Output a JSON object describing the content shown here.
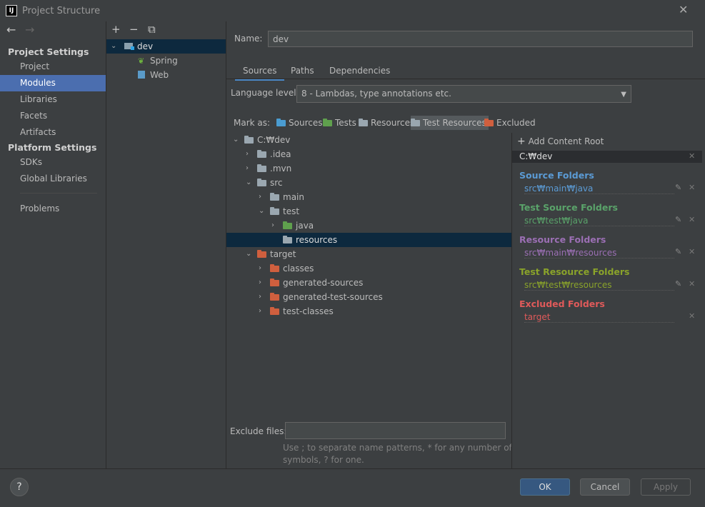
{
  "window": {
    "title": "Project Structure",
    "close": "✕"
  },
  "nav": {
    "back": "←",
    "forward": "→",
    "sections": [
      {
        "title": "Project Settings",
        "items": [
          "Project",
          "Modules",
          "Libraries",
          "Facets",
          "Artifacts"
        ]
      },
      {
        "title": "Platform Settings",
        "items": [
          "SDKs",
          "Global Libraries"
        ]
      }
    ],
    "problems": "Problems",
    "selected": "Modules"
  },
  "modules": {
    "toolbar": {
      "add": "+",
      "remove": "−",
      "copy": "⧉"
    },
    "tree": [
      {
        "label": "dev",
        "level": 0,
        "expanded": true
      },
      {
        "label": "Spring",
        "level": 1
      },
      {
        "label": "Web",
        "level": 1
      }
    ]
  },
  "module": {
    "name_label": "Name:",
    "name_value": "dev",
    "tabs": [
      "Sources",
      "Paths",
      "Dependencies"
    ],
    "active_tab": "Sources",
    "language_level_label": "Language level:",
    "language_level_value": "8 - Lambdas, type annotations etc.",
    "mark_as_label": "Mark as:",
    "mark_buttons": [
      "Sources",
      "Tests",
      "Resources",
      "Test Resources",
      "Excluded"
    ],
    "mark_selected": "Test Resources",
    "exclude_files_label": "Exclude files:",
    "exclude_files_value": "",
    "hint_line1": "Use ; to separate name patterns, * for any number of",
    "hint_line2": "symbols, ? for one."
  },
  "folder_tree": [
    {
      "label": "C:₩dev",
      "level": 0,
      "chevron": "down",
      "color": "gray"
    },
    {
      "label": ".idea",
      "level": 1,
      "chevron": "right",
      "color": "gray"
    },
    {
      "label": ".mvn",
      "level": 1,
      "chevron": "right",
      "color": "gray"
    },
    {
      "label": "src",
      "level": 1,
      "chevron": "down",
      "color": "gray"
    },
    {
      "label": "main",
      "level": 2,
      "chevron": "right",
      "color": "gray"
    },
    {
      "label": "test",
      "level": 2,
      "chevron": "down",
      "color": "gray"
    },
    {
      "label": "java",
      "level": 3,
      "chevron": "right",
      "color": "green"
    },
    {
      "label": "resources",
      "level": 3,
      "chevron": "",
      "color": "gray",
      "selected": true
    },
    {
      "label": "target",
      "level": 1,
      "chevron": "down",
      "color": "orange"
    },
    {
      "label": "classes",
      "level": 2,
      "chevron": "right",
      "color": "orange"
    },
    {
      "label": "generated-sources",
      "level": 2,
      "chevron": "right",
      "color": "orange"
    },
    {
      "label": "generated-test-sources",
      "level": 2,
      "chevron": "right",
      "color": "orange"
    },
    {
      "label": "test-classes",
      "level": 2,
      "chevron": "right",
      "color": "orange"
    }
  ],
  "content_roots": {
    "add_label": "Add Content Root",
    "root": "C:₩dev",
    "groups": [
      {
        "title": "Source Folders",
        "path": "src₩main₩java",
        "color": "#5b9bd5"
      },
      {
        "title": "Test Source Folders",
        "path": "src₩test₩java",
        "color": "#5aa36a"
      },
      {
        "title": "Resource Folders",
        "path": "src₩main₩resources",
        "color": "#9b6fb4"
      },
      {
        "title": "Test Resource Folders",
        "path": "src₩test₩resources",
        "color": "#8aa32a"
      },
      {
        "title": "Excluded Folders",
        "path": "target",
        "color": "#e05a5a"
      }
    ]
  },
  "footer": {
    "help": "?",
    "ok": "OK",
    "cancel": "Cancel",
    "apply": "Apply"
  }
}
